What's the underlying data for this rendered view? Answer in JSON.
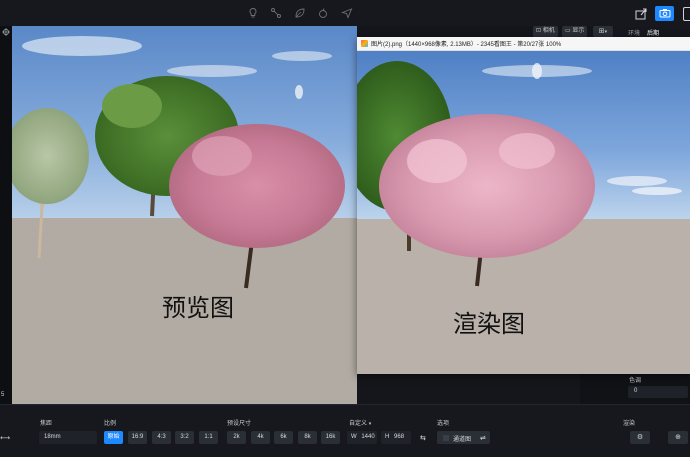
{
  "topbar": {
    "tool_icons": [
      "bulb-icon",
      "nodes-icon",
      "leaf-icon",
      "apple-icon",
      "paper-plane-icon"
    ]
  },
  "viewport": {
    "caption": "预览图"
  },
  "render_window": {
    "title": "图片(2).png（1440×968像素, 2.13MB）- 2345看图王 - 第20/27张 100%",
    "caption": "渲染图"
  },
  "viewport_buttons": {
    "camera_label": "相机",
    "display_label": "显示"
  },
  "right_panel": {
    "tab_env": "环境",
    "tab_post": "后期",
    "hue_label": "色调",
    "hue_value": "0"
  },
  "left_strip": {
    "number": "5"
  },
  "bottom": {
    "focal_label": "焦距",
    "focal_value": "18mm",
    "ratio_label": "比例",
    "ratio_options": [
      "原始",
      "16:9",
      "4:3",
      "3:2",
      "1:1"
    ],
    "ratio_selected": "原始",
    "preset_label": "预设尺寸",
    "preset_options": [
      "2k",
      "4k",
      "6k",
      "8k",
      "16k"
    ],
    "custom_label": "自定义",
    "width_prefix": "W",
    "width_value": "1440",
    "height_prefix": "H",
    "height_value": "968",
    "options_label": "选项",
    "channel_label": "通道图",
    "render_label": "渲染"
  },
  "colors": {
    "accent": "#1e88ff",
    "bg": "#14161b",
    "panel": "#16181d"
  }
}
